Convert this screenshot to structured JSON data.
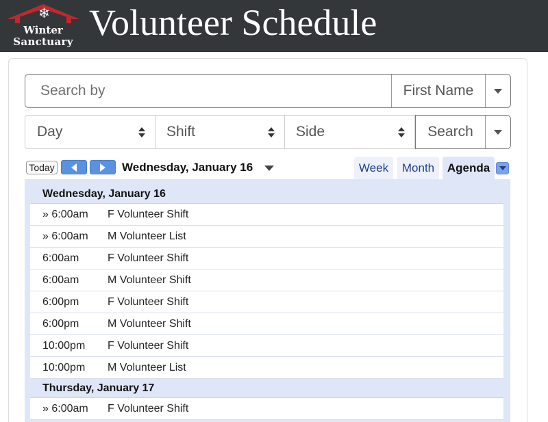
{
  "header": {
    "title": "Volunteer Schedule",
    "logo": {
      "line1": "Winter",
      "line2": "Sanctuary",
      "icon": "snowflake-icon",
      "roof_color": "#c0282d"
    }
  },
  "search": {
    "placeholder": "Search by",
    "field_selector": "First Name"
  },
  "filters": {
    "day": "Day",
    "shift": "Shift",
    "side": "Side",
    "search_button": "Search"
  },
  "toolbar": {
    "today": "Today",
    "current_date": "Wednesday, January 16",
    "views": [
      "Week",
      "Month",
      "Agenda"
    ],
    "active_view": "Agenda",
    "nav_color": "#5a92e0"
  },
  "agenda": {
    "days": [
      {
        "label": "Wednesday, January 16",
        "events": [
          {
            "time": "» 6:00am",
            "title": "F Volunteer Shift"
          },
          {
            "time": "» 6:00am",
            "title": "M Volunteer List"
          },
          {
            "time": "6:00am",
            "title": "F Volunteer Shift"
          },
          {
            "time": "6:00am",
            "title": "M Volunteer Shift"
          },
          {
            "time": "6:00pm",
            "title": "F Volunteer Shift"
          },
          {
            "time": "6:00pm",
            "title": "M Volunteer Shift"
          },
          {
            "time": "10:00pm",
            "title": "F Volunteer Shift"
          },
          {
            "time": "10:00pm",
            "title": "M Volunteer List"
          }
        ]
      },
      {
        "label": "Thursday, January 17",
        "events": [
          {
            "time": "» 6:00am",
            "title": "F Volunteer Shift"
          }
        ]
      }
    ]
  }
}
